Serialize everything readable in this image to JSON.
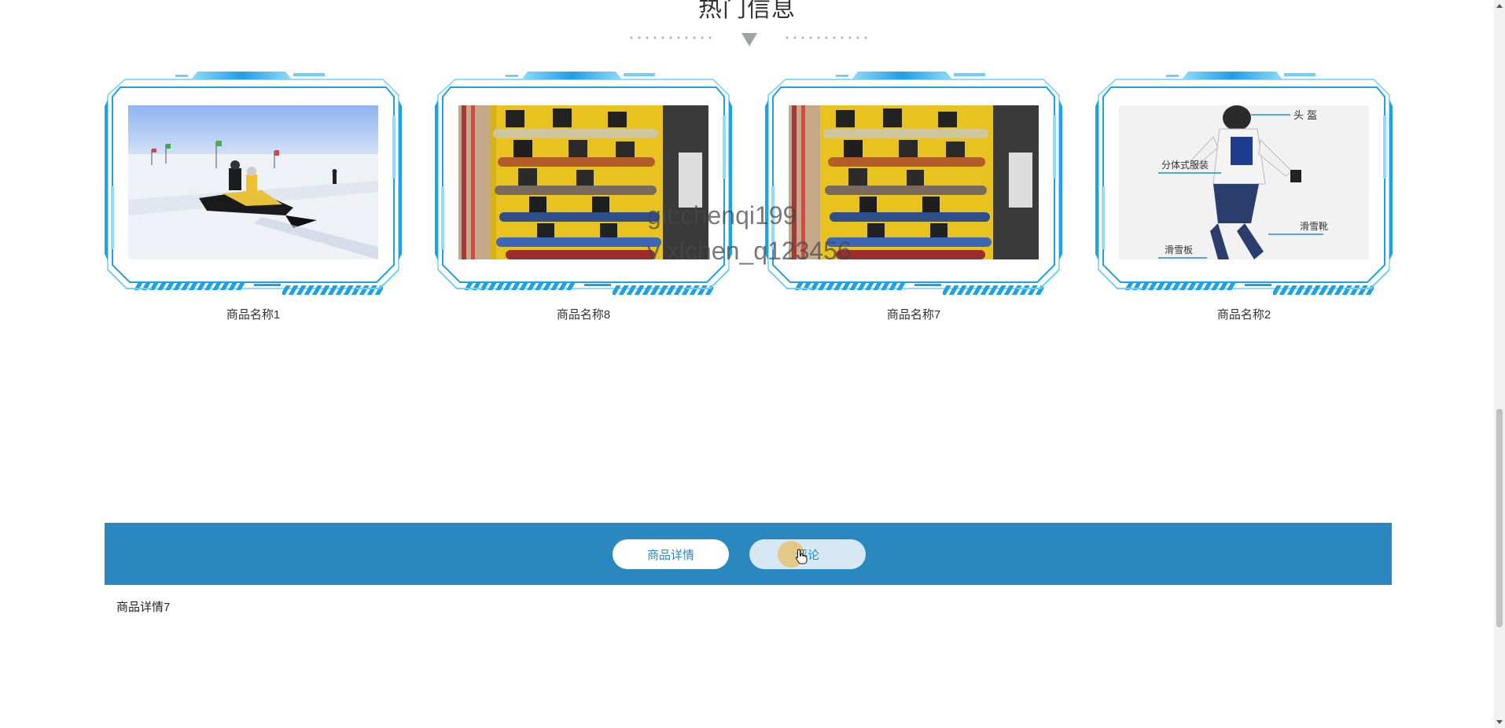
{
  "section": {
    "title": "热门信息"
  },
  "products": [
    {
      "name": "商品名称1",
      "image": "snowmobile-on-snow-photo"
    },
    {
      "name": "商品名称8",
      "image": "snowboard-rack-photo"
    },
    {
      "name": "商品名称7",
      "image": "snowboard-rack-photo"
    },
    {
      "name": "商品名称2",
      "image": "para-snowboarder-diagram-photo"
    }
  ],
  "diagram_labels": {
    "helmet": "头 盔",
    "suit": "分体式服装",
    "boots": "滑雪靴",
    "board": "滑雪板"
  },
  "tabs": {
    "detail": "商品详情",
    "comment": "评论"
  },
  "detail": {
    "text": "商品详情7"
  },
  "watermark": {
    "line1": "git:chenqi199",
    "line2": "v xlchen_q123456"
  },
  "colors": {
    "tabbar": "#2b87bf",
    "frame": "#1ea2e6",
    "frame_light": "#6fd0f5"
  }
}
